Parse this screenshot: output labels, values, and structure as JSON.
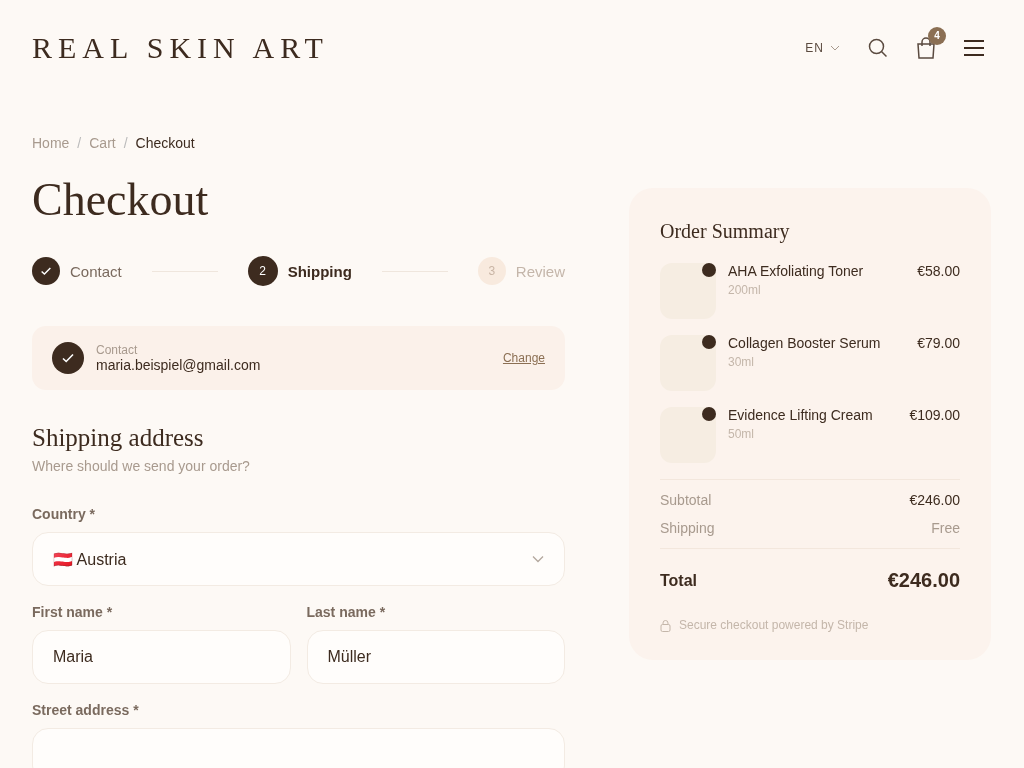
{
  "header": {
    "logo": "REAL SKIN ART",
    "language": "EN",
    "cart_count": "4"
  },
  "breadcrumb": [
    {
      "kind": "link",
      "label": "Home",
      "current": false
    },
    {
      "kind": "separator",
      "label": "/"
    },
    {
      "kind": "link",
      "label": "Cart",
      "current": false
    },
    {
      "kind": "separator",
      "label": "/"
    },
    {
      "kind": "link",
      "label": "Checkout",
      "current": true
    }
  ],
  "title": "Checkout",
  "steps": [
    {
      "label": "Contact",
      "completed": true,
      "selected": false
    },
    {
      "number": "2",
      "label": "Shipping",
      "completed": false,
      "selected": true
    },
    {
      "number": "3",
      "label": "Review",
      "completed": false,
      "selected": false
    }
  ],
  "contact_card": {
    "label": "Contact",
    "value": "maria.beispiel@gmail.com",
    "action": "Change"
  },
  "shipping": {
    "title": "Shipping address",
    "subtitle": "Where should we send your order?",
    "field_rows": [
      [
        {
          "label": "Country *",
          "value": "🇦🇹 Austria",
          "kind": "select"
        }
      ],
      [
        {
          "label": "First name *",
          "value": "Maria",
          "kind": "text"
        },
        {
          "label": "Last name *",
          "value": "Müller",
          "kind": "text"
        }
      ],
      [
        {
          "label": "Street address *",
          "kind": "text"
        }
      ]
    ]
  },
  "summary": {
    "title": "Order Summary",
    "items": [
      {
        "name": "AHA Exfoliating Toner",
        "size": "200ml",
        "price": "€58.00"
      },
      {
        "name": "Collagen Booster Serum",
        "size": "30ml",
        "price": "€79.00"
      },
      {
        "name": "Evidence Lifting Cream",
        "size": "50ml",
        "price": "€109.00"
      }
    ],
    "rows": [
      {
        "label": "Subtotal",
        "value": "€246.00",
        "kind": "amount"
      },
      {
        "label": "Shipping",
        "value": "Free",
        "kind": "muted"
      }
    ],
    "total": {
      "label": "Total",
      "value": "€246.00"
    },
    "secure_note": "Secure checkout powered by Stripe"
  }
}
